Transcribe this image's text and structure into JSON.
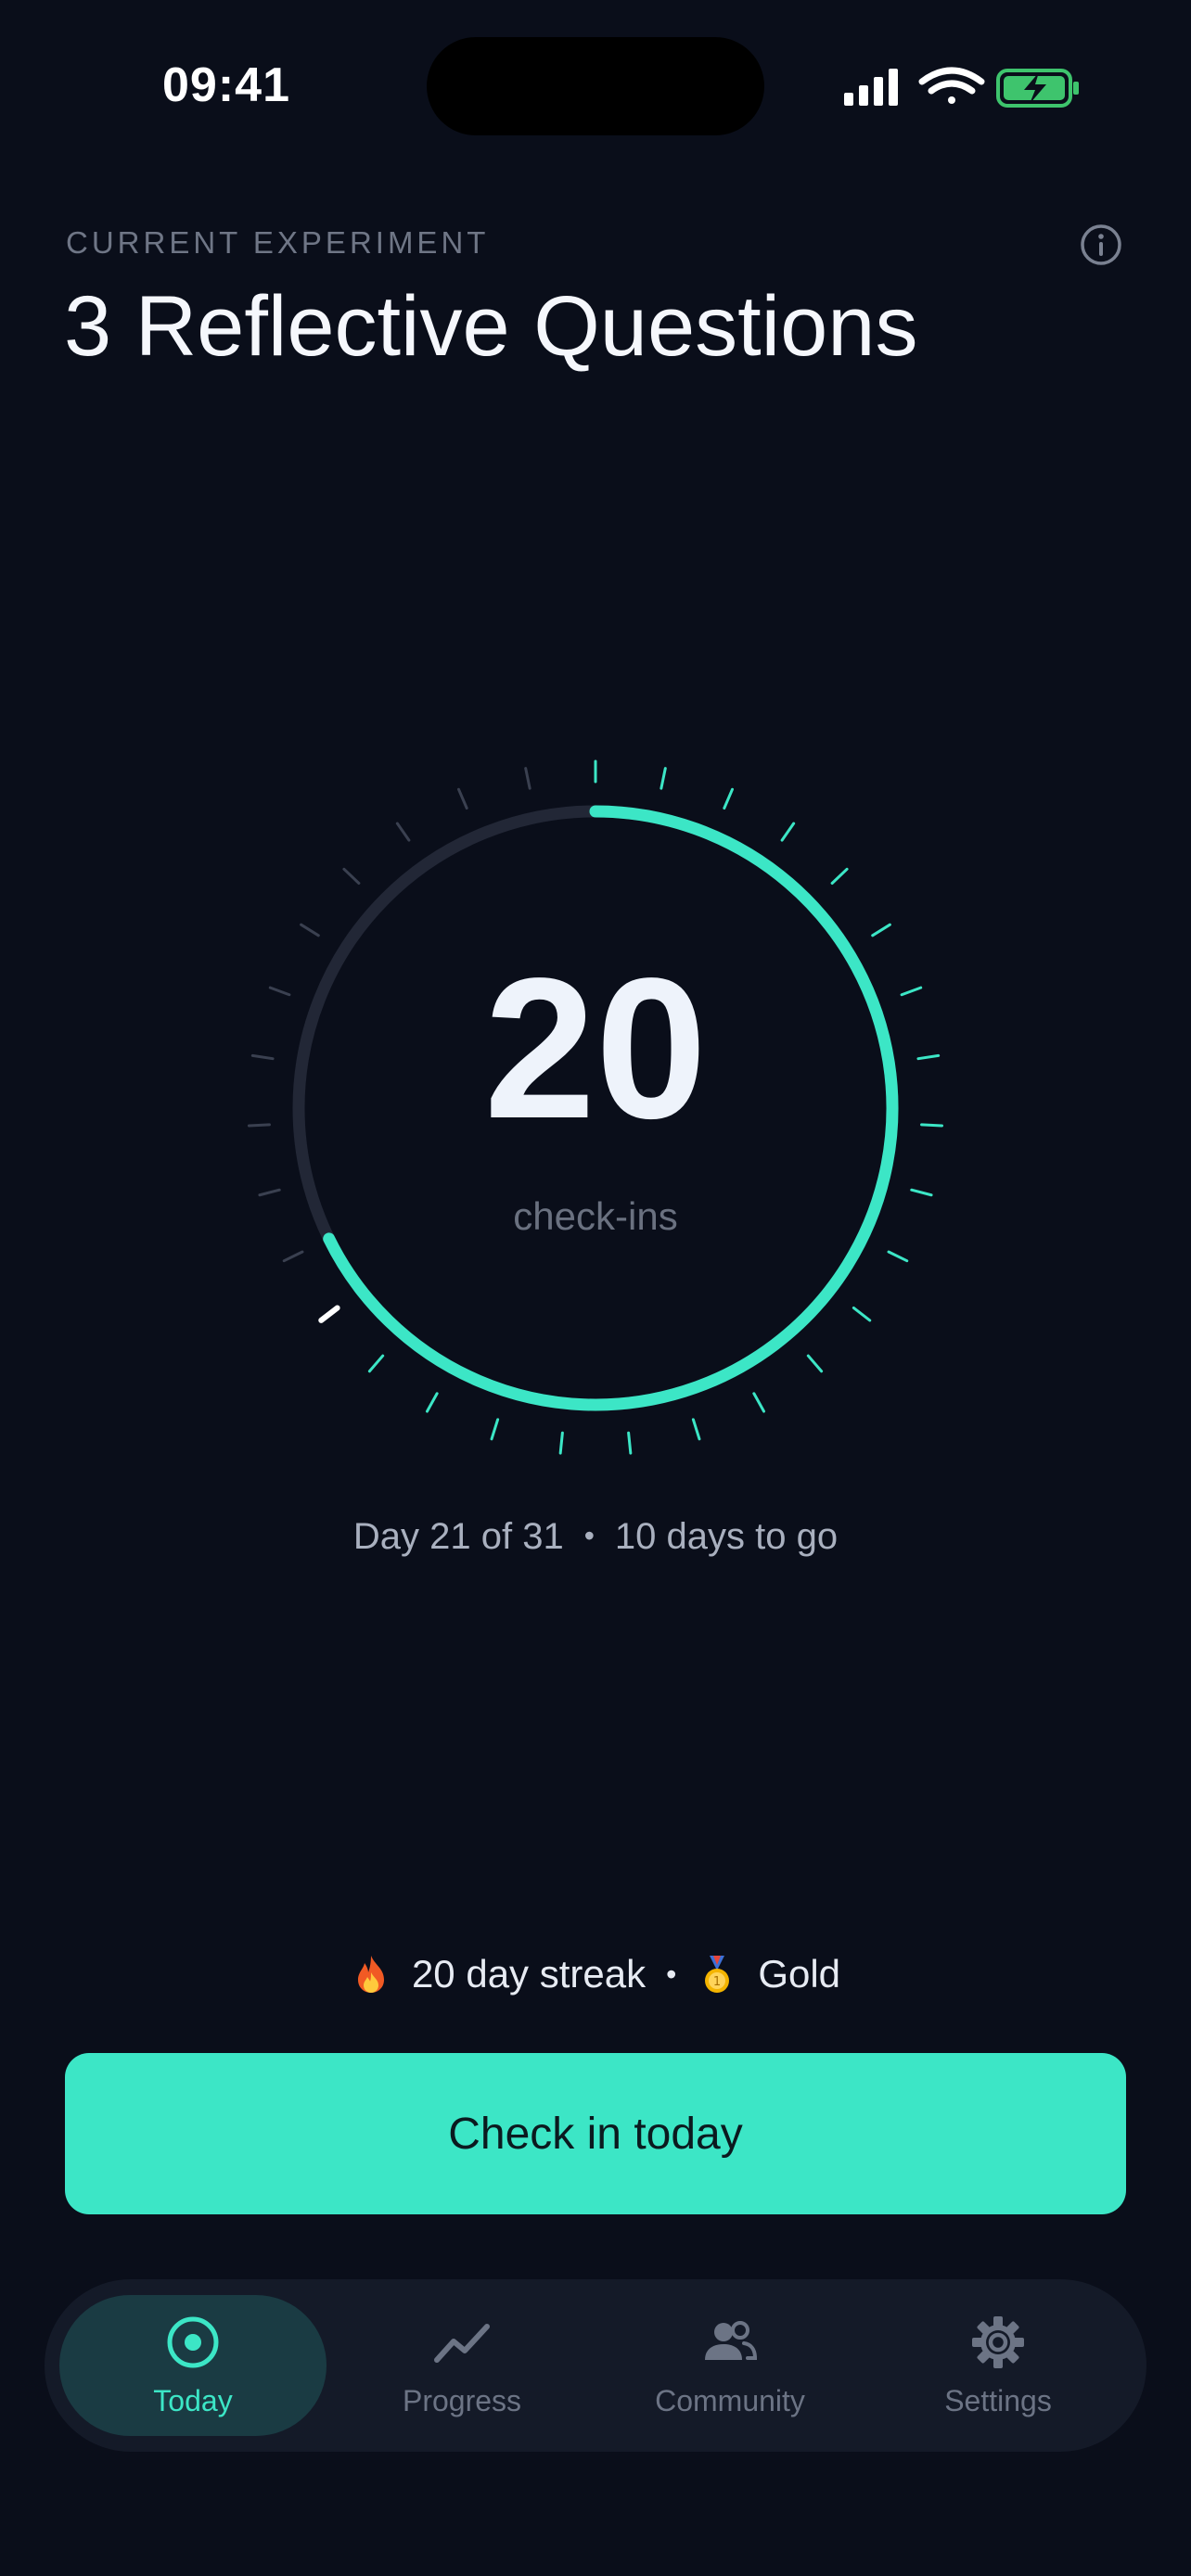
{
  "status_bar": {
    "time": "09:41"
  },
  "header": {
    "eyebrow": "CURRENT EXPERIMENT",
    "title": "3 Reflective Questions"
  },
  "progress": {
    "checkins": "20",
    "checkins_label": "check-ins",
    "current_day": 21,
    "total_days": 31,
    "day_text": "Day 21 of 31",
    "separator": "•",
    "remaining_text": "10 days to go"
  },
  "streak": {
    "streak_text": "20 day streak",
    "separator": "•",
    "badge_text": "Gold"
  },
  "cta": {
    "label": "Check in today"
  },
  "tabs": [
    {
      "label": "Today",
      "icon": "target-icon",
      "active": true
    },
    {
      "label": "Progress",
      "icon": "chart-line-icon",
      "active": false
    },
    {
      "label": "Community",
      "icon": "people-icon",
      "active": false
    },
    {
      "label": "Settings",
      "icon": "gear-icon",
      "active": false
    }
  ],
  "colors": {
    "background": "#0a0e1a",
    "accent": "#3ce6c6",
    "track": "#222736"
  }
}
